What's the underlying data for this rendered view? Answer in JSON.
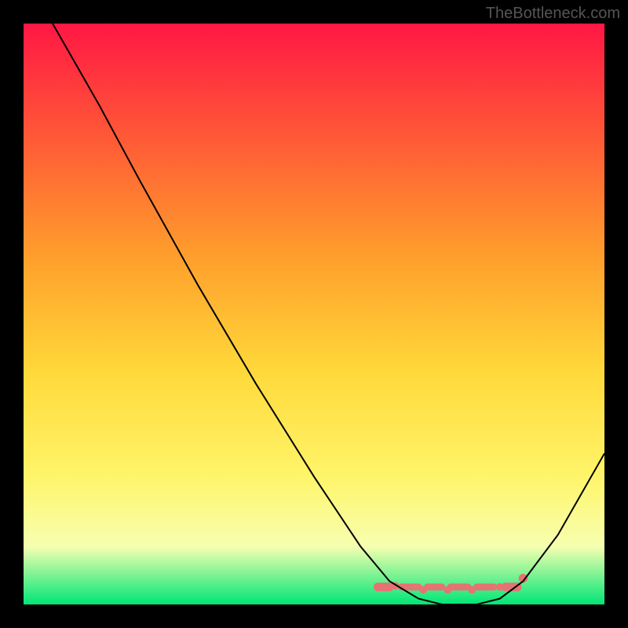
{
  "watermark": "TheBottleneck.com",
  "chart_data": {
    "type": "line",
    "title": "",
    "xlabel": "",
    "ylabel": "",
    "xlim": [
      0,
      100
    ],
    "ylim": [
      0,
      100
    ],
    "background_gradient": {
      "stops": [
        {
          "offset": 0,
          "color": "#ff1744"
        },
        {
          "offset": 20,
          "color": "#ff5a36"
        },
        {
          "offset": 40,
          "color": "#ff9e2c"
        },
        {
          "offset": 60,
          "color": "#ffd93a"
        },
        {
          "offset": 78,
          "color": "#fff56a"
        },
        {
          "offset": 90,
          "color": "#f6ffb0"
        },
        {
          "offset": 100,
          "color": "#00e676"
        }
      ]
    },
    "series": [
      {
        "name": "bottleneck-curve",
        "color": "#000000",
        "stroke_width": 2,
        "points": [
          {
            "x": 5,
            "y": 100
          },
          {
            "x": 9,
            "y": 93
          },
          {
            "x": 13,
            "y": 86
          },
          {
            "x": 20,
            "y": 73
          },
          {
            "x": 30,
            "y": 55
          },
          {
            "x": 40,
            "y": 38
          },
          {
            "x": 50,
            "y": 22
          },
          {
            "x": 58,
            "y": 10
          },
          {
            "x": 63,
            "y": 4
          },
          {
            "x": 68,
            "y": 1
          },
          {
            "x": 72,
            "y": 0
          },
          {
            "x": 78,
            "y": 0
          },
          {
            "x": 82,
            "y": 1
          },
          {
            "x": 86,
            "y": 4
          },
          {
            "x": 92,
            "y": 12
          },
          {
            "x": 100,
            "y": 26
          }
        ]
      }
    ],
    "highlight_band": {
      "name": "optimal-range",
      "color": "#e57373",
      "y": 3,
      "segments": [
        {
          "x1": 61,
          "x2": 63,
          "thick": 5
        },
        {
          "x1": 65,
          "x2": 68,
          "thick": 4
        },
        {
          "x1": 69.5,
          "x2": 72,
          "thick": 4
        },
        {
          "x1": 73.5,
          "x2": 76.5,
          "thick": 4
        },
        {
          "x1": 78,
          "x2": 81,
          "thick": 4
        },
        {
          "x1": 83,
          "x2": 85,
          "thick": 5
        }
      ],
      "dots": [
        {
          "x": 64,
          "y": 3.2,
          "r": 2.2
        },
        {
          "x": 68.8,
          "y": 2.5,
          "r": 2.2
        },
        {
          "x": 73,
          "y": 2.5,
          "r": 2.2
        },
        {
          "x": 77.2,
          "y": 2.5,
          "r": 2.2
        },
        {
          "x": 82,
          "y": 3,
          "r": 2.2
        },
        {
          "x": 86,
          "y": 4.5,
          "r": 2.6
        }
      ]
    }
  }
}
